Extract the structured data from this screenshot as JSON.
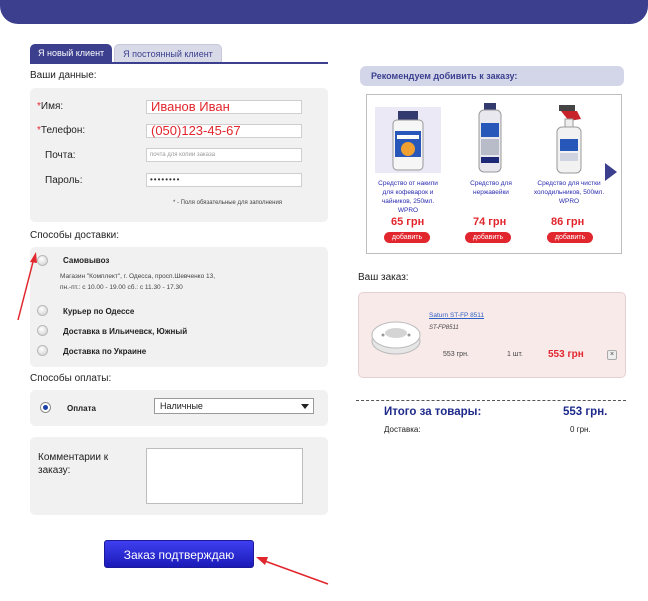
{
  "tabs": {
    "new_client": "Я новый клиент",
    "regular_client": "Я постоянный клиент"
  },
  "your_data": {
    "title": "Ваши данные:",
    "name_label": "Имя:",
    "name_value": "Иванов Иван",
    "phone_label": "Телефон:",
    "phone_value": "(050)123-45-67",
    "email_label": "Почта:",
    "email_placeholder": "почта для копии заказа",
    "password_label": "Пароль:",
    "password_value": "••••••••",
    "required_mark": "*",
    "required_note": "* - Поля обязательные для заполнения"
  },
  "delivery": {
    "title": "Способы доставки:",
    "options": [
      {
        "label": "Самовывоз",
        "checked": false
      },
      {
        "label": "Курьер по Одессе",
        "checked": false
      },
      {
        "label": "Доставка в Ильичевск, Южный",
        "checked": false
      },
      {
        "label": "Доставка по Украине",
        "checked": false
      }
    ],
    "pickup_address_line1": "Магазин \"Комплект\", г. Одесса, просп.Шевченко 13,",
    "pickup_address_line2": "пн.-пт.: с 10.00 - 19.00 сб.: с 11.30 - 17.30"
  },
  "payment": {
    "title": "Способы оплаты:",
    "label": "Оплата",
    "selected": "Наличные"
  },
  "comments": {
    "label_line1": "Комментарии к",
    "label_line2": "заказу:"
  },
  "submit_label": "Заказ подтверждаю",
  "recommend": {
    "title": "Рекомендуем добивить к заказу:",
    "products": [
      {
        "name": "Средство от накипи для кофеварок и чайников, 250мл. WPRO",
        "price": "65 грн",
        "add": "добавить"
      },
      {
        "name": "Средство для нержавейки",
        "price": "74 грн",
        "add": "добавить"
      },
      {
        "name": "Средство для чистки холодильников, 500мл. WPRO",
        "price": "86 грн",
        "add": "добавить"
      }
    ]
  },
  "order": {
    "title": "Ваш заказ:",
    "item_name": "Saturn ST-FP 8511",
    "item_sku": "ST-FP8511",
    "unit_price": "553 грн.",
    "qty": "1 шт.",
    "total": "553 грн",
    "remove": "×"
  },
  "summary": {
    "total_label": "Итого за товары:",
    "total_value": "553 грн.",
    "delivery_label": "Доставка:",
    "delivery_value": "0 грн."
  },
  "colors": {
    "brand": "#3b3f8e",
    "accent_red": "#e1262d",
    "submit_blue": "#2424d0"
  }
}
